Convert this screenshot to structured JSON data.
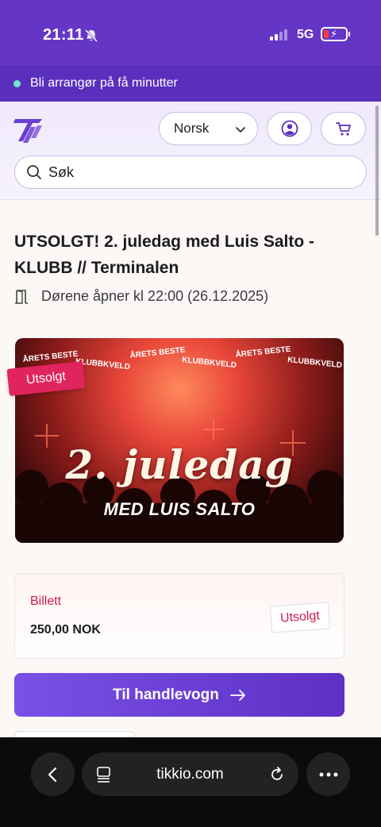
{
  "status_bar": {
    "time": "21:11",
    "network": "5G"
  },
  "promo": {
    "text": "Bli arrangør på få minutter"
  },
  "header": {
    "language": "Norsk",
    "search_placeholder": "Søk"
  },
  "event": {
    "title": "UTSOLGT! 2. juledag med Luis Salto - KLUBB // Terminalen",
    "doors_text": "Dørene åpner kl 22:00 (26.12.2025)",
    "sold_out_tag": "Utsolgt",
    "hero": {
      "arc_text": "ÅRETS BESTE KLUBBKVELD",
      "headline": "2. juledag",
      "subline": "MED LUIS SALTO"
    }
  },
  "ticket": {
    "name": "Billett",
    "price": "250,00 NOK",
    "status": "Utsolgt"
  },
  "cart_button": {
    "label": "Til handlevogn"
  },
  "browser": {
    "url": "tikkio.com"
  },
  "colors": {
    "brand_purple": "#6536c6",
    "accent_pink": "#d01c4d",
    "tag_pink": "#e0245e"
  }
}
